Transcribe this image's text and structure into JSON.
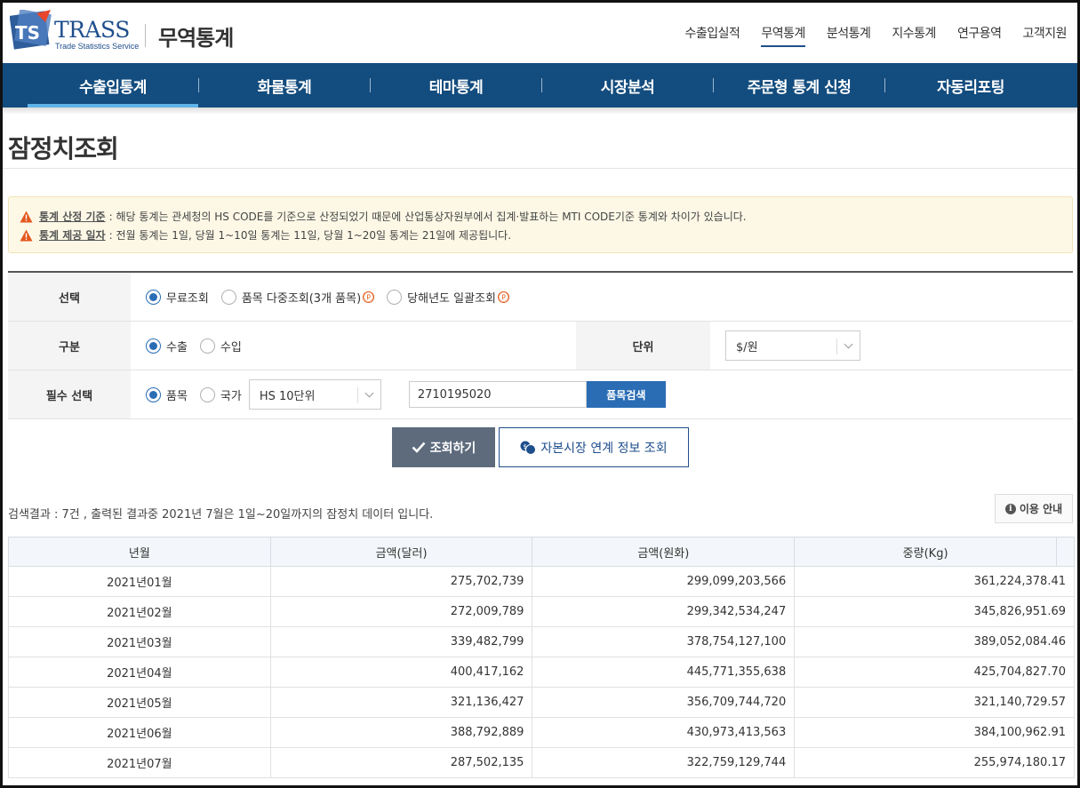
{
  "brand": {
    "logo_text": "TRASS",
    "logo_sub": "Trade Statistics Service",
    "site_title": "무역통계"
  },
  "gnb": [
    "수출입실적",
    "무역통계",
    "분석통계",
    "지수통계",
    "연구용역",
    "고객지원"
  ],
  "nav": [
    "수출입통계",
    "화물통계",
    "테마통계",
    "시장분석",
    "주문형 통계 신청",
    "자동리포팅"
  ],
  "page_title": "잠정치조회",
  "notice": [
    {
      "key": "통계 산정 기준",
      "text": ": 해당 통계는 관세청의 HS CODE를 기준으로 산정되었기 때문에 산업통상자원부에서 집계·발표하는 MTI CODE기준 통계와 차이가 있습니다."
    },
    {
      "key": "통계 제공 일자",
      "text": ": 전월 통계는 1일, 당월 1~10일 통계는 11일, 당월 1~20일 통계는 21일에 제공됩니다."
    }
  ],
  "form": {
    "select_label": "선택",
    "select_options": [
      "무료조회",
      "품목 다중조회(3개 품목)",
      "당해년도 일괄조회"
    ],
    "type_label": "구분",
    "type_options": [
      "수출",
      "수입"
    ],
    "unit_label": "단위",
    "unit_value": "$/원",
    "required_label": "필수 선택",
    "required_options": [
      "품목",
      "국가"
    ],
    "hs_select": "HS 10단위",
    "code_value": "2710195020",
    "search_button": "품목검색",
    "p_mark": "ⓟ"
  },
  "actions": {
    "query": "조회하기",
    "capital": "자본시장 연계 정보 조회"
  },
  "result_text": "검색결과 : 7건 ,  출력된 결과중 2021년 7월은 1일~20일까지의 잠정치 데이터 입니다.",
  "guide_button": "이용 안내",
  "table": {
    "headers": [
      "년월",
      "금액(달러)",
      "금액(원화)",
      "중량(Kg)"
    ],
    "rows": [
      [
        "2021년01월",
        "275,702,739",
        "299,099,203,566",
        "361,224,378.41"
      ],
      [
        "2021년02월",
        "272,009,789",
        "299,342,534,247",
        "345,826,951.69"
      ],
      [
        "2021년03월",
        "339,482,799",
        "378,754,127,100",
        "389,052,084.46"
      ],
      [
        "2021년04월",
        "400,417,162",
        "445,771,355,638",
        "425,704,827.70"
      ],
      [
        "2021년05월",
        "321,136,427",
        "356,709,744,720",
        "321,140,729.57"
      ],
      [
        "2021년06월",
        "388,792,889",
        "430,973,413,563",
        "384,100,962.91"
      ],
      [
        "2021년07월",
        "287,502,135",
        "322,759,129,744",
        "255,974,180.17"
      ]
    ]
  }
}
